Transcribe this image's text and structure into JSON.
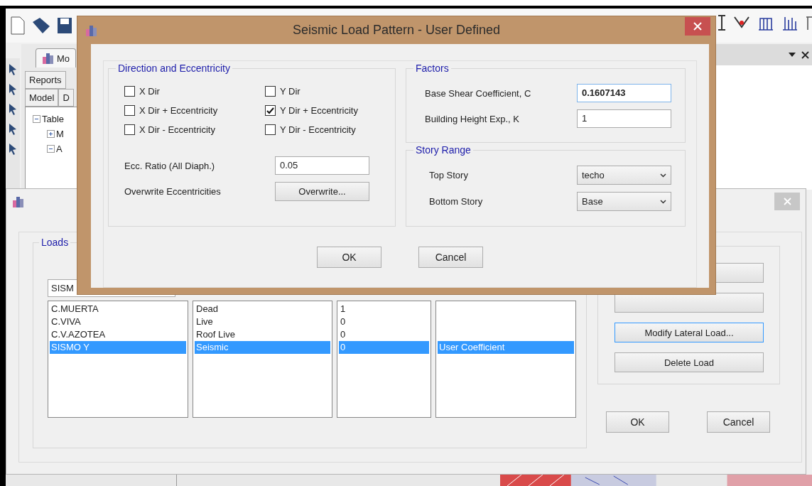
{
  "model_panel": {
    "window_tab": "Mo",
    "tabs": [
      {
        "label": "Reports"
      }
    ],
    "subtabs": [
      {
        "label": "Model"
      },
      {
        "label": "D"
      }
    ],
    "tree": [
      {
        "label": "Table",
        "expanded": true,
        "children": [
          {
            "label": "M",
            "expanded": false
          },
          {
            "label": "A",
            "expanded": true
          }
        ]
      }
    ]
  },
  "load_patterns_dialog": {
    "loads_legend": "Loads",
    "name_value": "SISM",
    "rows": [
      {
        "cells": [
          "C.MUERTA",
          "Dead",
          "1"
        ],
        "selected": false
      },
      {
        "cells": [
          "C.VIVA",
          "Live",
          "0"
        ],
        "selected": false
      },
      {
        "cells": [
          "C.V.AZOTEA",
          "Roof Live",
          "0"
        ],
        "selected": false
      },
      {
        "cells": [
          "SISMO Y",
          "Seismic",
          "0",
          "User Coefficient"
        ],
        "selected": true
      }
    ],
    "buttons": [
      {
        "label": "Modify Lateral Load...",
        "focused": true
      },
      {
        "label": "Delete Load",
        "focused": false
      }
    ],
    "footer_buttons": [
      "OK",
      "Cancel"
    ]
  },
  "seismic_dialog": {
    "title": "Seismic Load Pattern - User Defined",
    "direction": {
      "legend": "Direction and Eccentricity",
      "options": [
        {
          "label": "X Dir",
          "checked": false
        },
        {
          "label": "Y Dir",
          "checked": false
        },
        {
          "label": "X Dir + Eccentricity",
          "checked": false
        },
        {
          "label": "Y Dir + Eccentricity",
          "checked": true
        },
        {
          "label": "X Dir - Eccentricity",
          "checked": false
        },
        {
          "label": "Y Dir - Eccentricity",
          "checked": false
        }
      ],
      "ecc_ratio": {
        "label": "Ecc. Ratio (All Diaph.)",
        "value": "0.05"
      },
      "overwrite": {
        "label": "Overwrite Eccentricities",
        "button": "Overwrite..."
      }
    },
    "factors": {
      "legend": "Factors",
      "fields": [
        {
          "label": "Base Shear Coefficient, C",
          "value": "0.1607143",
          "focused": true
        },
        {
          "label": "Building Height Exp., K",
          "value": "1",
          "focused": false
        }
      ]
    },
    "story_range": {
      "legend": "Story Range",
      "fields": [
        {
          "label": "Top Story",
          "value": "techo"
        },
        {
          "label": "Bottom Story",
          "value": "Base"
        }
      ]
    },
    "buttons": [
      "OK",
      "Cancel"
    ]
  }
}
